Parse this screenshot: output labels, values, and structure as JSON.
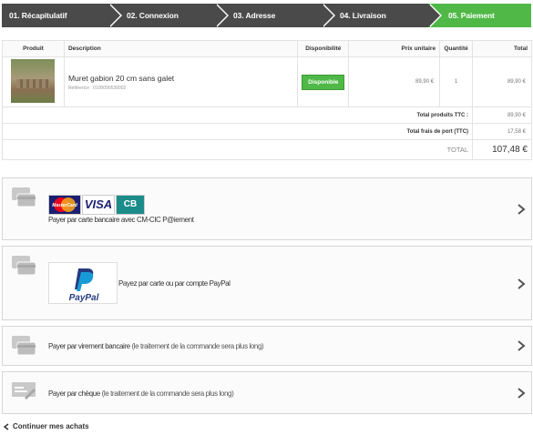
{
  "steps": [
    {
      "label": "01. Récapitulatif",
      "active": false
    },
    {
      "label": "02. Connexion",
      "active": false
    },
    {
      "label": "03. Adresse",
      "active": false
    },
    {
      "label": "04. Livraison",
      "active": false
    },
    {
      "label": "05. Paiement",
      "active": true
    }
  ],
  "cart": {
    "headers": {
      "product": "Produit",
      "description": "Description",
      "availability": "Disponibilité",
      "unit_price": "Prix unitaire",
      "quantity": "Quantité",
      "total": "Total"
    },
    "item": {
      "name": "Muret gabion 20 cm sans galet",
      "reference": "Référence : 0100090530002",
      "availability": "Disponible",
      "unit_price": "89,90 €",
      "quantity": "1",
      "total": "89,90 €"
    },
    "summary": {
      "products_label": "Total produits TTC :",
      "products_value": "89,90 €",
      "shipping_label": "Total frais de port (TTC)",
      "shipping_value": "17,58 €",
      "total_label": "TOTAL",
      "total_value": "107,48 €"
    }
  },
  "payment": {
    "card": {
      "label": "Payer par carte bancaire avec CM-CIC P@iement",
      "logos": [
        "MasterCard",
        "VISA",
        "CB"
      ]
    },
    "paypal": {
      "label": "Payez par carte ou par compte PayPal",
      "logo_text": "PayPal"
    },
    "transfer": {
      "label": "Payer par virement bancaire",
      "note": "(le traitement de la commande sera plus long)"
    },
    "cheque": {
      "label": "Payer par chèque",
      "note": "(le traitement de la commande sera plus long)"
    }
  },
  "continue_label": "Continuer mes achats",
  "colors": {
    "active_step": "#4fb847",
    "inactive_step": "#4a4a4a",
    "available_badge": "#4fb847"
  }
}
